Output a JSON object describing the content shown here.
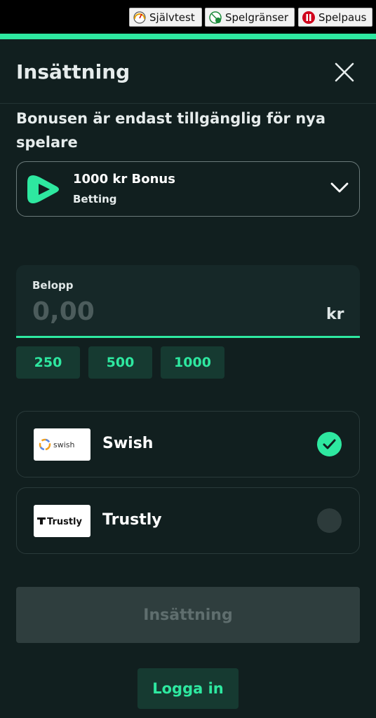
{
  "regulatory": {
    "self_test": "Självtest",
    "limits": "Spelgränser",
    "pause": "Spelpaus"
  },
  "header": {
    "title": "Insättning"
  },
  "bonus": {
    "note": "Bonusen är endast tillgänglig för nya spelare",
    "title": "1000 kr Bonus",
    "subtitle": "Betting"
  },
  "amount": {
    "label": "Belopp",
    "value": "0,00",
    "unit": "kr",
    "quick": [
      "250",
      "500",
      "1000"
    ]
  },
  "methods": [
    {
      "name": "Swish",
      "logo_text": "swish",
      "selected": true
    },
    {
      "name": "Trustly",
      "logo_text": "Trustly",
      "selected": false
    }
  ],
  "actions": {
    "deposit": "Insättning",
    "login": "Logga in"
  },
  "colors": {
    "accent": "#2ee8a0",
    "background": "#111f1f"
  }
}
